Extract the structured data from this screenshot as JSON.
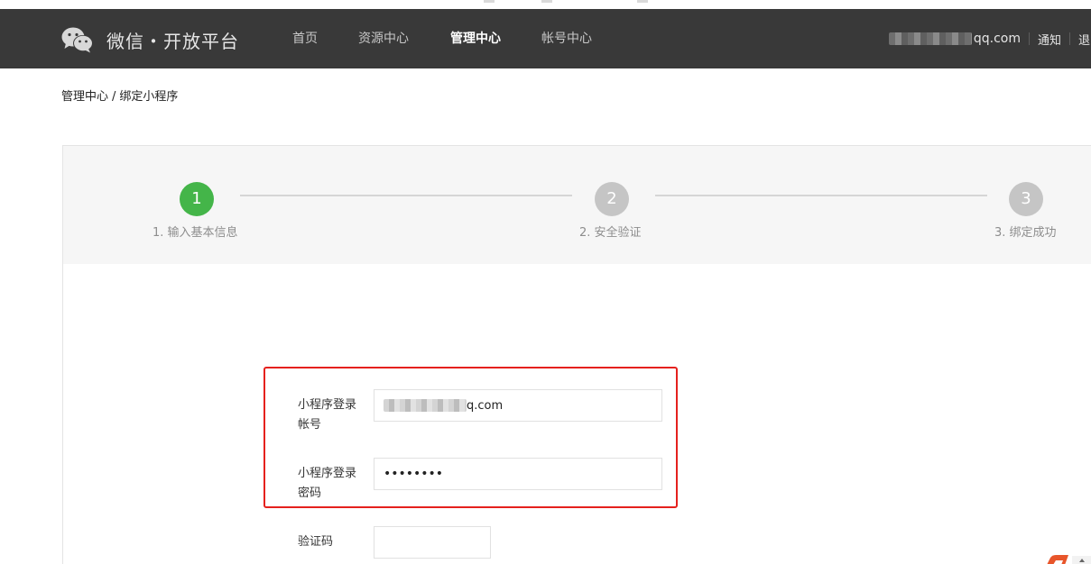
{
  "header": {
    "logo_icon": "wechat-icon",
    "brand": "微信・开放平台",
    "nav": [
      {
        "label": "首页",
        "active": false
      },
      {
        "label": "资源中心",
        "active": false
      },
      {
        "label": "管理中心",
        "active": true
      },
      {
        "label": "帐号中心",
        "active": false
      }
    ],
    "account_suffix": "qq.com",
    "notify": "通知",
    "logout": "退出"
  },
  "breadcrumb": {
    "parent": "管理中心",
    "separator": "/",
    "current": "绑定小程序"
  },
  "steps": [
    {
      "number": "1",
      "label": "1. 输入基本信息",
      "state": "active"
    },
    {
      "number": "2",
      "label": "2. 安全验证",
      "state": "todo"
    },
    {
      "number": "3",
      "label": "3. 绑定成功",
      "state": "todo"
    }
  ],
  "form": {
    "account_label_line1": "小程序登录",
    "account_label_line2": "帐号",
    "account_value_suffix": "q.com",
    "password_label_line1": "小程序登录",
    "password_label_line2": "密码",
    "password_value": "••••••••",
    "captcha_label": "验证码",
    "captcha_value": ""
  },
  "colors": {
    "nav_bg": "#393939",
    "step_active": "#44b549",
    "step_inactive": "#c5c5c5",
    "highlight_border": "#e5211d"
  }
}
